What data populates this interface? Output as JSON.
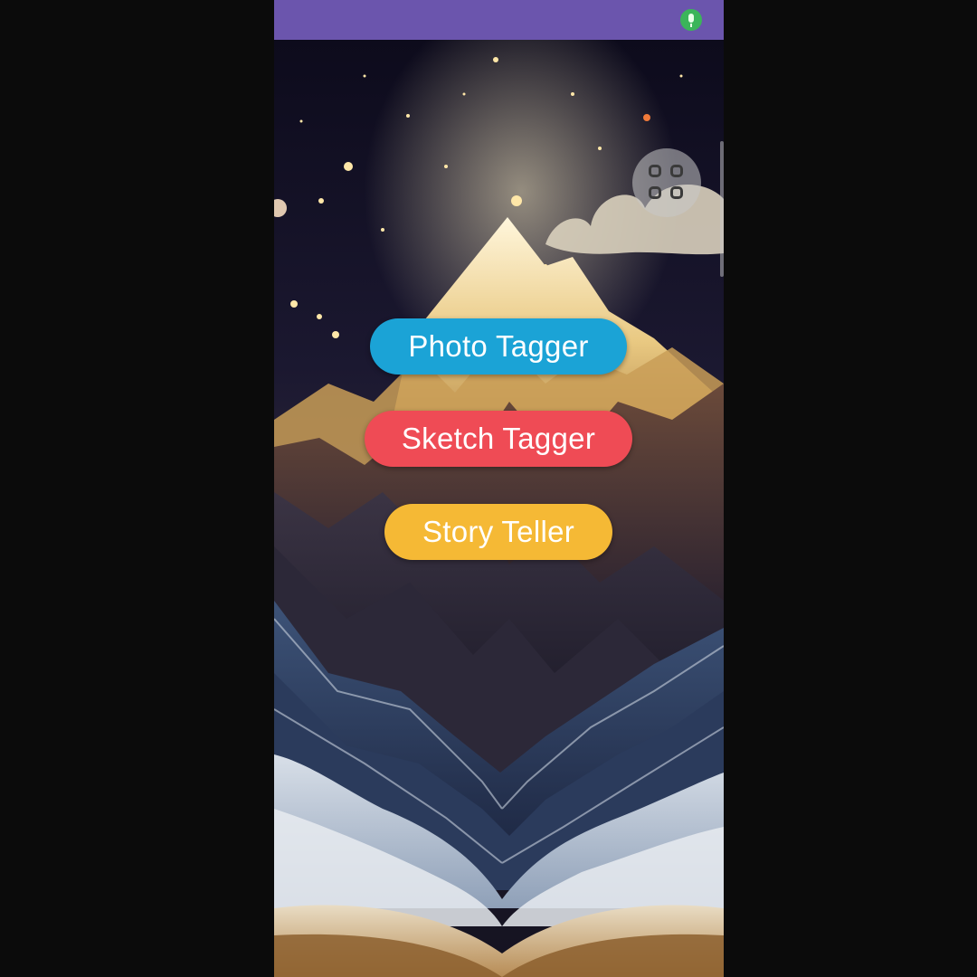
{
  "status_bar": {
    "color": "#6b55ad",
    "indicator_icon": "mic-icon",
    "indicator_color": "#3bb55a"
  },
  "launcher": {
    "apps_button_icon": "app-grid-icon"
  },
  "menu": {
    "buttons": [
      {
        "label": "Photo Tagger",
        "color": "#1ba3d6"
      },
      {
        "label": "Sketch Tagger",
        "color": "#ef4b55"
      },
      {
        "label": "Story Teller",
        "color": "#f5b935"
      }
    ]
  },
  "background": {
    "description_icon": "mountain-book-wallpaper"
  }
}
